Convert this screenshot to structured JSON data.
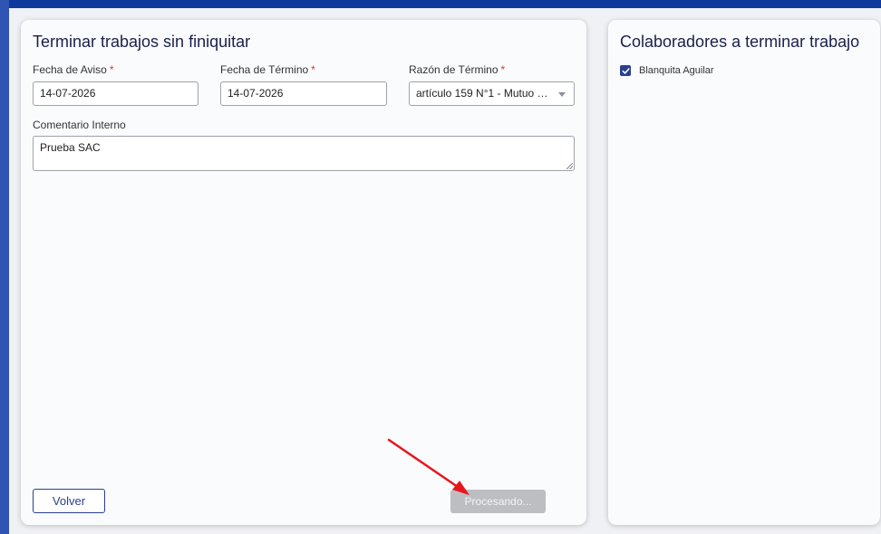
{
  "form": {
    "title": "Terminar trabajos sin finiquitar",
    "fecha_aviso": {
      "label": "Fecha de Aviso",
      "required_mark": "*",
      "value": "14-07-2026"
    },
    "fecha_termino": {
      "label": "Fecha de Término",
      "required_mark": "*",
      "value": "14-07-2026"
    },
    "razon_termino": {
      "label": "Razón de Término",
      "required_mark": "*",
      "value": "artículo 159 N°1 - Mutuo ac..."
    },
    "comentario": {
      "label": "Comentario Interno",
      "value": "Prueba SAC"
    },
    "volver_label": "Volver",
    "procesando_label": "Procesando..."
  },
  "colaboradores": {
    "title": "Colaboradores a terminar trabajo",
    "items": [
      {
        "name": "Blanquita Aguilar",
        "checked": true
      }
    ]
  },
  "colors": {
    "top_bar": "#0f3a9c",
    "left_bar": "#2f54b4",
    "primary": "#2a3f8f",
    "required": "#e03030",
    "disabled_button": "#bdbec2",
    "annotation_arrow": "#e8161b"
  }
}
